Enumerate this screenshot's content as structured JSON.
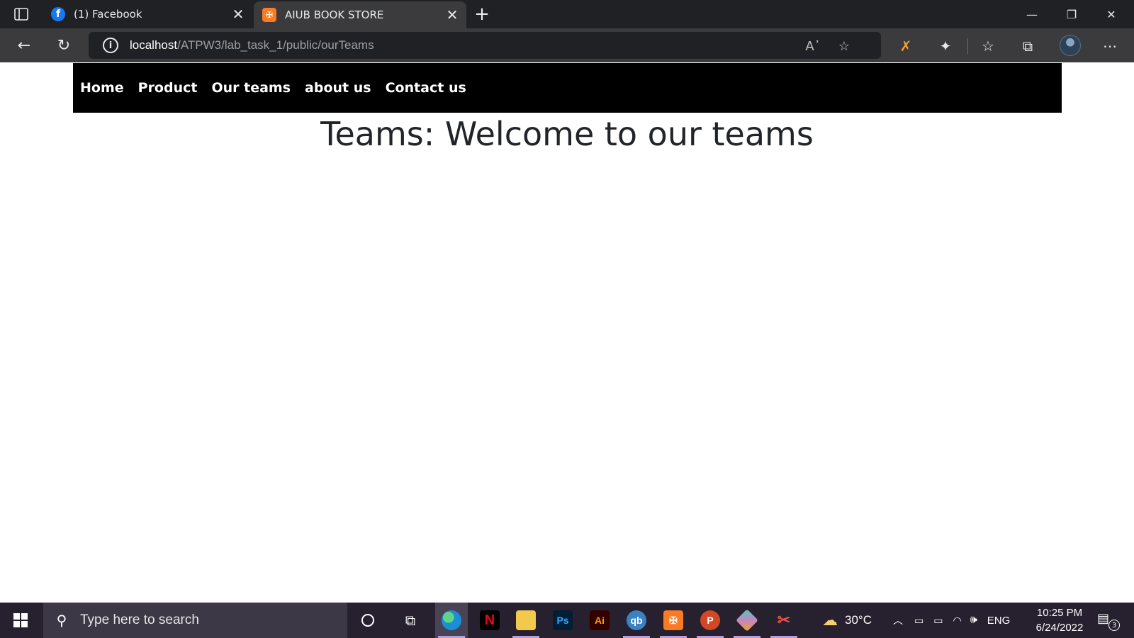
{
  "browser": {
    "tabs": [
      {
        "title": "(1) Facebook",
        "icon": "facebook-icon",
        "active": false
      },
      {
        "title": "AIUB BOOK STORE",
        "icon": "xampp-icon",
        "active": true
      }
    ],
    "url_host": "localhost",
    "url_path": "/ATPW3/lab_task_1/public/ourTeams"
  },
  "site": {
    "nav": [
      "Home",
      "Product",
      "Our teams",
      "about us",
      "Contact us"
    ],
    "heading": "Teams: Welcome to our teams"
  },
  "taskbar": {
    "search_placeholder": "Type here to search",
    "weather": "30°C",
    "language": "ENG",
    "time": "10:25 PM",
    "date": "6/24/2022",
    "notifications": "3",
    "apps": [
      "cortana-icon",
      "task-view-icon",
      "edge-icon",
      "netflix-icon",
      "file-explorer-icon",
      "photoshop-icon",
      "illustrator-icon",
      "qbittorrent-icon",
      "xampp-icon",
      "powerpoint-icon",
      "git-icon",
      "snipping-tool-icon"
    ]
  }
}
